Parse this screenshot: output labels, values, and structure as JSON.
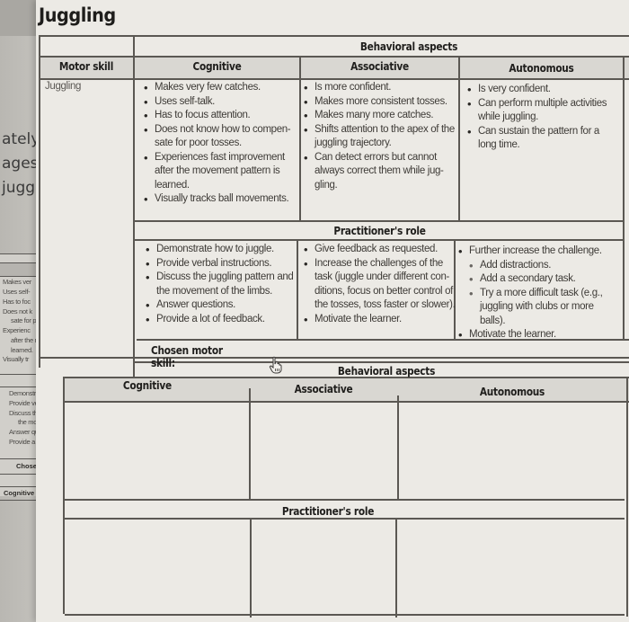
{
  "background_screen": {
    "text_fragments": [
      "ately t",
      "ages,",
      "juggli"
    ],
    "mini_table": {
      "cognitive_items": [
        "Makes ver",
        "Uses self-",
        "Has to foc",
        "Does not k",
        "sate for po",
        "Experienc",
        "after the m",
        "learned.",
        "Visually tr"
      ],
      "practitioner_items": [
        "Demonstr",
        "Provide ve",
        "Discuss th",
        "the moven",
        "Answer qu",
        "Provide a"
      ],
      "chosen_label": "Chosen mo",
      "cognitive_header": "Cognitive"
    }
  },
  "document": {
    "title": "Juggling",
    "table1": {
      "behavioral_aspects_header": "Behavioral aspects",
      "columns": [
        "Motor skill",
        "Cognitive",
        "Associative",
        "Autonomous"
      ],
      "motor_skill": "Juggling",
      "cognitive": [
        "Makes very few catches.",
        "Uses self-talk.",
        "Has to focus attention.",
        "Does not know how to compen-\nsate for poor tosses.",
        "Experiences fast improvement\nafter the movement pattern is\nlearned.",
        "Visually tracks ball movements."
      ],
      "associative": [
        "Is more confident.",
        "Makes more consistent tosses.",
        "Makes many more catches.",
        "Shifts attention to the apex of the\njuggling trajectory.",
        "Can detect errors but cannot\nalways correct them while jug-\ngling."
      ],
      "autonomous": [
        "Is very confident.",
        "Can perform multiple activities\nwhile juggling.",
        "Can sustain the pattern for a\nlong time."
      ],
      "practitioner_role_header": "Practitioner's role",
      "practitioner_cognitive": [
        "Demonstrate how to juggle.",
        "Provide verbal instructions.",
        "Discuss the juggling pattern and\nthe movement of the limbs.",
        "Answer questions.",
        "Provide a lot of feedback."
      ],
      "practitioner_associative": [
        "Give feedback as requested.",
        "Increase the challenges of the\ntask (juggle under different con-\nditions, focus on better control of\nthe tosses, toss faster or slower).",
        "Motivate the learner."
      ],
      "practitioner_autonomous": [
        {
          "text": "Further increase the challenge.",
          "level": 0
        },
        {
          "text": "Add distractions.",
          "level": 1
        },
        {
          "text": "Add a secondary task.",
          "level": 1
        },
        {
          "text": "Try a more difficult task (e.g.,\njuggling with clubs or more\nballs).",
          "level": 1
        },
        {
          "text": "Motivate the learner.",
          "level": 0
        }
      ]
    },
    "table2": {
      "chosen_motor_skill_label": "Chosen motor skill:",
      "chosen_motor_skill_value": "",
      "behavioral_aspects_header": "Behavioral aspects",
      "columns": [
        "Cognitive",
        "Associative",
        "Autonomous"
      ],
      "practitioner_role_header": "Practitioner's role"
    }
  }
}
